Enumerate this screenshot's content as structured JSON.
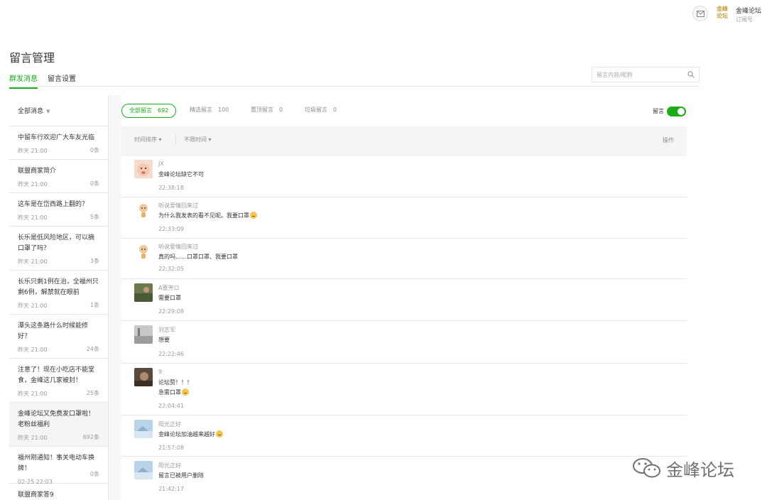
{
  "header": {
    "account_logo_text": "金峰论坛",
    "account_name": "金峰论坛",
    "account_type": "订阅号"
  },
  "page": {
    "title": "留言管理",
    "tabs": [
      "群发消息",
      "留言设置"
    ],
    "search_placeholder": "留言内容/昵称"
  },
  "sidebar": {
    "filter_label": "全部消息",
    "articles": [
      {
        "title": "中留车行欢迎广大车友光临",
        "time": "昨天 21:00",
        "count": "0条"
      },
      {
        "title": "联盟商家简介",
        "time": "昨天 21:00",
        "count": "0条"
      },
      {
        "title": "这车是在岱西路上翻的？",
        "time": "昨天 21:00",
        "count": "5条"
      },
      {
        "title": "长乐是低风险地区，可以摘口罩了吗？",
        "time": "昨天 21:00",
        "count": "3条"
      },
      {
        "title": "长乐只剩1例在治，全福州只剩6例，解禁就在眼前",
        "time": "昨天 21:00",
        "count": "1条"
      },
      {
        "title": "潭头这条路什么时候能修好？",
        "time": "昨天 21:00",
        "count": "24条"
      },
      {
        "title": "注意了！现在小吃店不能堂食，金峰这几家被封！",
        "time": "昨天 21:00",
        "count": "25条"
      },
      {
        "title": "金峰论坛又免费发口罩啦！老粉丝福利",
        "time": "昨天 21:00",
        "count": "692条"
      },
      {
        "title": "福州刚通知！事关电动车换牌！",
        "time": "02-25 22:03",
        "count": "0条"
      },
      {
        "title": "联盟商家答9",
        "time": "",
        "count": ""
      }
    ]
  },
  "filters": [
    {
      "label": "全部留言",
      "count": "692"
    },
    {
      "label": "精选留言",
      "count": "100"
    },
    {
      "label": "置顶留言",
      "count": "0"
    },
    {
      "label": "垃圾留言",
      "count": "0"
    }
  ],
  "comment_toggle": {
    "label": "留言",
    "on": true
  },
  "table": {
    "sort_label": "时间排序",
    "range_label": "不限时间",
    "action_header": "操作"
  },
  "comments": [
    {
      "nick": "JX",
      "lines": [
        "金峰论坛缺它不可"
      ],
      "time": "22:38:18",
      "avatar_icon": "baby-face-avatar"
    },
    {
      "nick": "听说爱情回来过",
      "lines": [
        "为什么我发表的看不见呢。我要口罩"
      ],
      "time": "22:33:09",
      "avatar_icon": "cartoon-avatar",
      "emoji_line": 0
    },
    {
      "nick": "听说爱情回来过",
      "lines": [
        "真的吗……口罩口罩、我要口罩"
      ],
      "time": "22:32:05",
      "avatar_icon": "cartoon-avatar"
    },
    {
      "nick": "A蔷芳ロ",
      "lines": [
        "需要口罩"
      ],
      "time": "22:29:08",
      "avatar_icon": "photo-avatar"
    },
    {
      "nick": "刘志军",
      "lines": [
        "想要"
      ],
      "time": "22:22:46",
      "avatar_icon": "grey-photo-avatar"
    },
    {
      "nick": "9",
      "lines": [
        "论坛赞！！！",
        "急需口罩"
      ],
      "time": "22:04:41",
      "avatar_icon": "photo-avatar",
      "emoji_line": 1
    },
    {
      "nick": "阳光正好",
      "lines": [
        "金峰论坛加油越来越好"
      ],
      "time": "21:57:08",
      "avatar_icon": "sky-avatar",
      "emoji_line": 0
    },
    {
      "nick": "阳光正好",
      "lines": [
        "留言已被用户删除"
      ],
      "time": "21:42:17",
      "avatar_icon": "sky-avatar"
    }
  ],
  "watermark": {
    "text": "金峰论坛",
    "icon": "wechat-icon"
  },
  "colors": {
    "accent": "#1aad19",
    "text": "#353535",
    "muted": "#9a9a9a",
    "border": "#e7e7eb"
  }
}
